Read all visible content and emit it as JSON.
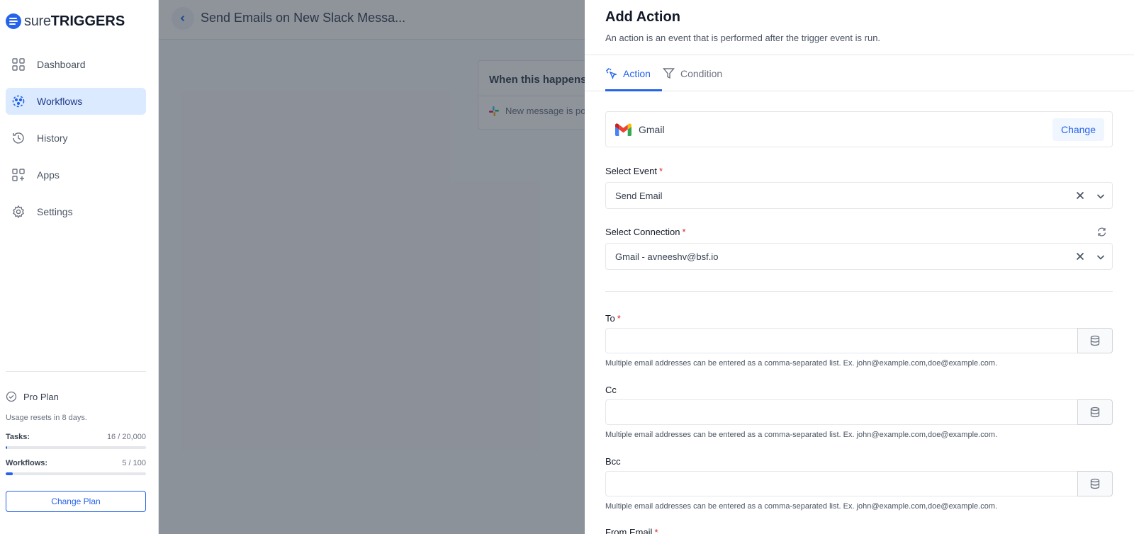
{
  "sidebar": {
    "logo": {
      "light": "sure",
      "bold": "TRIGGERS"
    },
    "nav": [
      {
        "label": "Dashboard",
        "icon": "grid-icon"
      },
      {
        "label": "Workflows",
        "icon": "workflow-icon"
      },
      {
        "label": "History",
        "icon": "history-icon"
      },
      {
        "label": "Apps",
        "icon": "apps-icon"
      },
      {
        "label": "Settings",
        "icon": "gear-icon"
      }
    ],
    "plan": {
      "title": "Pro Plan",
      "reset_text": "Usage resets in 8 days.",
      "tasks_label": "Tasks:",
      "tasks_value": "16 / 20,000",
      "tasks_fraction": 0.0008,
      "workflows_label": "Workflows:",
      "workflows_value": "5 / 100",
      "workflows_fraction": 0.05,
      "change_button": "Change Plan"
    }
  },
  "workflow": {
    "title": "Send Emails on New Slack Messa...",
    "trigger_heading": "When this happens",
    "trigger_item": "New message is po"
  },
  "drawer": {
    "title": "Add Action",
    "subtitle": "An action is an event that is performed after the trigger event is run.",
    "tabs": {
      "action": "Action",
      "condition": "Condition"
    },
    "app": {
      "name": "Gmail",
      "change_label": "Change"
    },
    "event": {
      "label": "Select Event",
      "value": "Send Email"
    },
    "connection": {
      "label": "Select Connection",
      "value": "Gmail - avneeshv@bsf.io"
    },
    "fields": {
      "to": {
        "label": "To",
        "value": "",
        "help": "Multiple email addresses can be entered as a comma-separated list. Ex. john@example.com,doe@example.com."
      },
      "cc": {
        "label": "Cc",
        "value": "",
        "help": "Multiple email addresses can be entered as a comma-separated list. Ex. john@example.com,doe@example.com."
      },
      "bcc": {
        "label": "Bcc",
        "value": "",
        "help": "Multiple email addresses can be entered as a comma-separated list. Ex. john@example.com,doe@example.com."
      },
      "from_email": {
        "label": "From Email"
      }
    }
  },
  "colors": {
    "accent": "#2563eb",
    "required": "#dc2626",
    "border": "#e5e7eb"
  }
}
